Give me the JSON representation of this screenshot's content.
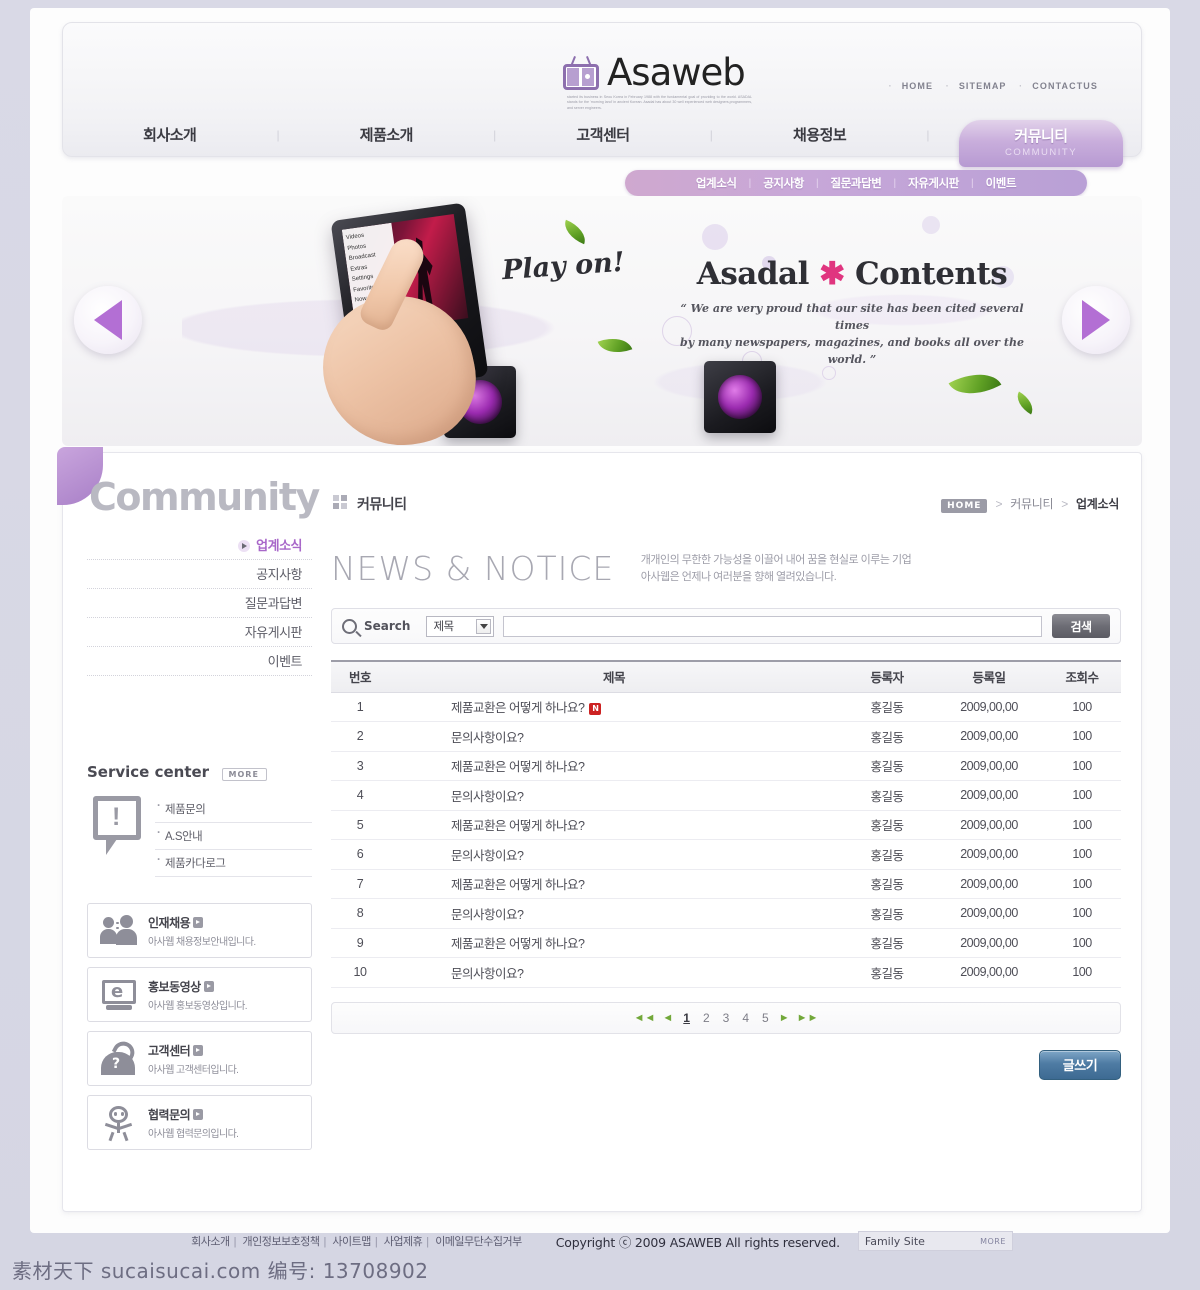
{
  "header": {
    "logo_text": "Asaweb",
    "logo_icon": "tv-icon",
    "logo_description": "started its business in Seou Korea in February 1988 with the fundamental goal of providing to the world. ASADAL stands for the 'morning land' in ancient Korean. Asadal has about 30 well experienced web designers,programmers, and server engineers.",
    "utility_nav": [
      "HOME",
      "SITEMAP",
      "CONTACTUS"
    ],
    "main_nav": [
      "회사소개",
      "제품소개",
      "고객센터",
      "채용정보"
    ],
    "active_nav": {
      "kr": "커뮤니티",
      "en": "COMMUNITY"
    },
    "sub_nav": [
      "업계소식",
      "공지사항",
      "질문과답변",
      "자유게시판",
      "이벤트"
    ]
  },
  "hero": {
    "play_on": "Play on!",
    "tablet_menu": [
      "Videos",
      "Photos",
      "Broadcast",
      "Extras",
      "Settings",
      "Favorite Songs",
      "Now Playing"
    ],
    "title_left": "Asadal",
    "title_star": "✱",
    "title_right": "Contents",
    "quote_line1": "“ We are very proud that our site has been cited several times",
    "quote_line2": "by many newspapers, magazines, and books all over the world. ”",
    "prev_label": "prev-slide",
    "next_label": "next-slide"
  },
  "content": {
    "section_title_en": "Community",
    "section_title_kr": "커뮤니티",
    "breadcrumb": {
      "home": "HOME",
      "level1": "커뮤니티",
      "level2": "업계소식"
    },
    "sidebar_menu": [
      {
        "label": "업계소식",
        "active": true
      },
      {
        "label": "공지사항",
        "active": false
      },
      {
        "label": "질문과답변",
        "active": false
      },
      {
        "label": "자유게시판",
        "active": false
      },
      {
        "label": "이벤트",
        "active": false
      }
    ],
    "service_center": {
      "title": "Service center",
      "more": "MORE",
      "links": [
        "제품문의",
        "A.S안내",
        "제품카다로그"
      ]
    },
    "banners": [
      {
        "icon": "people-icon",
        "title": "인재채용",
        "sub": "아사웹 채용정보안내입니다."
      },
      {
        "icon": "monitor-icon",
        "title": "홍보동영상",
        "sub": "아사웹 홍보동영상입니다."
      },
      {
        "icon": "phone-icon",
        "title": "고객센터",
        "sub": "아사웹 고객센터입니다."
      },
      {
        "icon": "person-icon",
        "title": "협력문의",
        "sub": "아사웹 협력문의입니다."
      }
    ],
    "page_title": "NEWS & NOTICE",
    "page_sub_line1": "개개인의 무한한 가능성을 이끌어 내어 꿈을 현실로 이루는 기업",
    "page_sub_line2": "아사웹은 언제나 여러분을 향해 열려있습니다.",
    "search": {
      "label": "Search",
      "select_value": "제목",
      "input_value": "",
      "placeholder": "",
      "button": "검색"
    },
    "table": {
      "headers": [
        "번호",
        "제목",
        "등록자",
        "등록일",
        "조회수"
      ],
      "rows": [
        {
          "no": "1",
          "title": "제품교환은 어떻게 하나요?",
          "new": true,
          "author": "홍길동",
          "date": "2009,00,00",
          "views": "100"
        },
        {
          "no": "2",
          "title": "문의사항이요?",
          "new": false,
          "author": "홍길동",
          "date": "2009,00,00",
          "views": "100"
        },
        {
          "no": "3",
          "title": "제품교환은 어떻게 하나요?",
          "new": false,
          "author": "홍길동",
          "date": "2009,00,00",
          "views": "100"
        },
        {
          "no": "4",
          "title": "문의사항이요?",
          "new": false,
          "author": "홍길동",
          "date": "2009,00,00",
          "views": "100"
        },
        {
          "no": "5",
          "title": "제품교환은 어떻게 하나요?",
          "new": false,
          "author": "홍길동",
          "date": "2009,00,00",
          "views": "100"
        },
        {
          "no": "6",
          "title": "문의사항이요?",
          "new": false,
          "author": "홍길동",
          "date": "2009,00,00",
          "views": "100"
        },
        {
          "no": "7",
          "title": "제품교환은 어떻게 하나요?",
          "new": false,
          "author": "홍길동",
          "date": "2009,00,00",
          "views": "100"
        },
        {
          "no": "8",
          "title": "문의사항이요?",
          "new": false,
          "author": "홍길동",
          "date": "2009,00,00",
          "views": "100"
        },
        {
          "no": "9",
          "title": "제품교환은 어떻게 하나요?",
          "new": false,
          "author": "홍길동",
          "date": "2009,00,00",
          "views": "100"
        },
        {
          "no": "10",
          "title": "문의사항이요?",
          "new": false,
          "author": "홍길동",
          "date": "2009,00,00",
          "views": "100"
        }
      ]
    },
    "pagination": {
      "pages": [
        "1",
        "2",
        "3",
        "4",
        "5"
      ],
      "current": "1"
    },
    "write_button": "글쓰기"
  },
  "footer": {
    "links": [
      "회사소개",
      "개인정보보호정책",
      "사이트맵",
      "사업제휴",
      "이메일무단수집거부"
    ],
    "copyright": "Copyright ⓒ 2009 ASAWEB  All rights reserved.",
    "family_site": "Family  Site",
    "family_more": "MORE"
  },
  "watermark": "素材天下 sucaisucai.com  编号: 13708902",
  "colors": {
    "accent_purple": "#b79ad2",
    "accent_pink": "#e0357f",
    "link_blue": "#4e7ba3",
    "new_badge_red": "#cc2222"
  }
}
